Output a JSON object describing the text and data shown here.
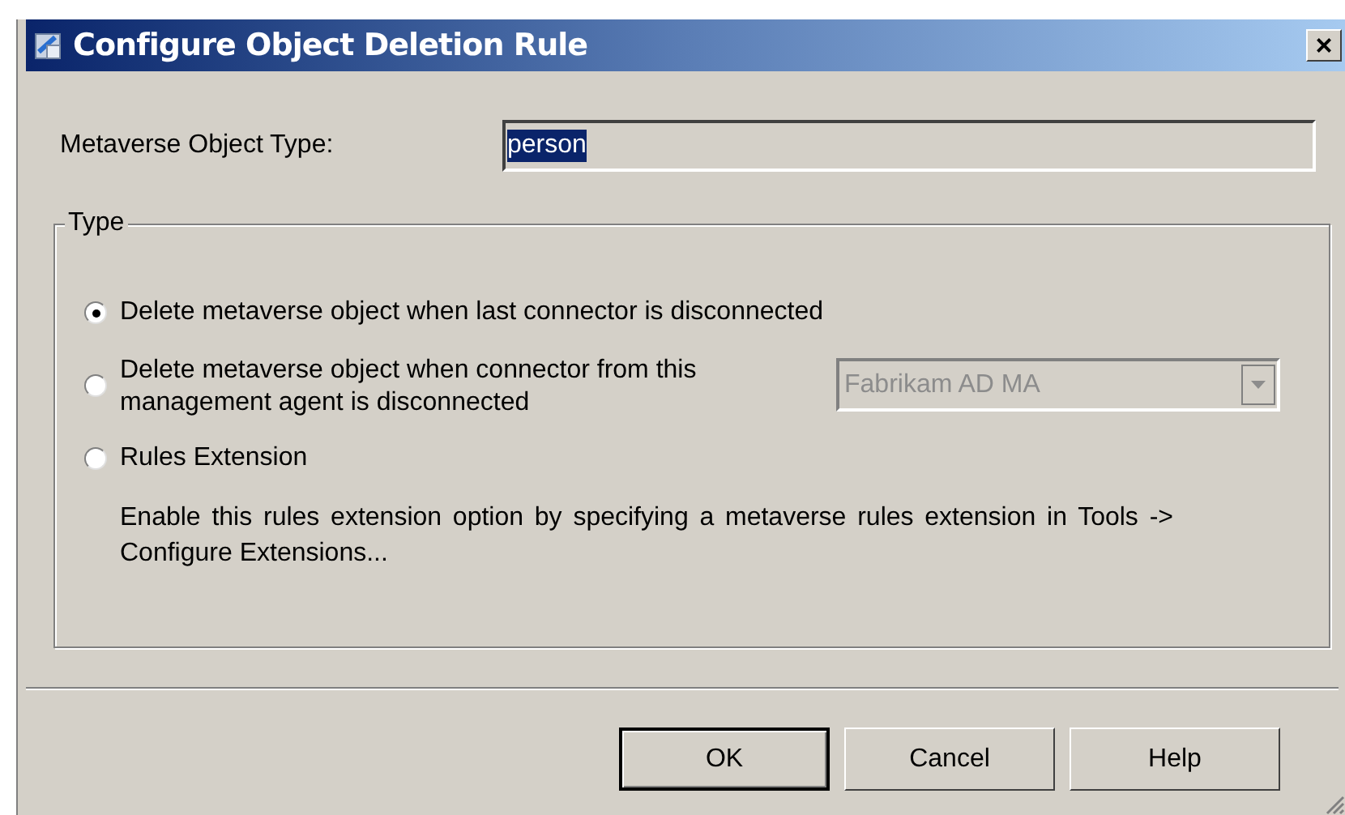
{
  "window": {
    "title": "Configure Object Deletion Rule",
    "close": "×"
  },
  "object_type": {
    "label": "Metaverse Object Type:",
    "value": "person",
    "selected_text": true
  },
  "type_group": {
    "legend": "Type",
    "options": [
      {
        "kind": "plain",
        "label": "Delete metaverse object when last connector is disconnected",
        "selected": true
      },
      {
        "kind": "combo",
        "label": "Delete metaverse object when connector from this management agent is disconnected",
        "selected": false,
        "combo": {
          "value": "Fabrikam AD MA",
          "disabled": true
        }
      },
      {
        "kind": "note",
        "label": "Rules Extension",
        "selected": false,
        "note": "Enable this rules extension option by specifying a metaverse rules extension in Tools -> Configure Extensions..."
      }
    ]
  },
  "buttons": [
    {
      "label": "OK",
      "default": true
    },
    {
      "label": "Cancel",
      "default": false
    },
    {
      "label": "Help",
      "default": false
    }
  ]
}
